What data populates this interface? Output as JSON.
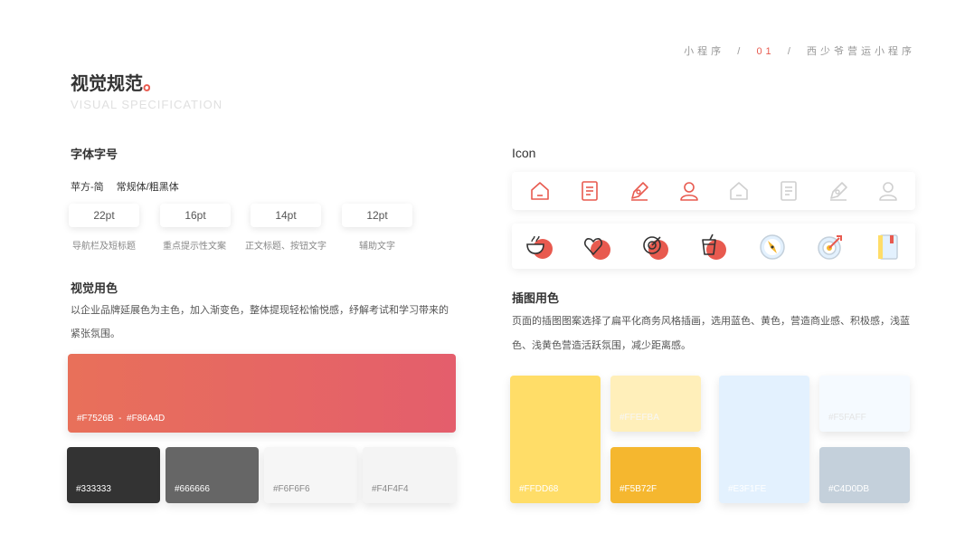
{
  "header": {
    "breadcrumb_left": "小程序",
    "breadcrumb_sep1": "/",
    "breadcrumb_num": "01",
    "breadcrumb_sep2": "/",
    "breadcrumb_right": "西少爷营运小程序",
    "title": "视觉规范",
    "title_dot": "。",
    "subtitle": "VISUAL SPECIFICATION"
  },
  "typography": {
    "heading": "字体字号",
    "font_name": "苹方-简",
    "font_weights": "常规体/粗黑体",
    "sizes": [
      {
        "size": "22pt",
        "usage": "导航栏及短标题"
      },
      {
        "size": "16pt",
        "usage": "重点提示性文案"
      },
      {
        "size": "14pt",
        "usage": "正文标题、按钮文字"
      },
      {
        "size": "12pt",
        "usage": "辅助文字"
      }
    ]
  },
  "visual_colors": {
    "heading": "视觉用色",
    "desc_line1": "以企业品牌延展色为主色，加入渐变色，整体提现轻松愉悦感，纾解考试和学习带来的",
    "desc_line2": "紧张氛围。",
    "gradient": {
      "label": "#F7526B  -  #F86A4D",
      "from": "#E8705A",
      "to": "#E45E6C"
    },
    "swatches": [
      {
        "label": "#333333",
        "color": "#333333",
        "text": "#ffffff"
      },
      {
        "label": "#666666",
        "color": "#666666",
        "text": "#ffffff"
      },
      {
        "label": "#F6F6F6",
        "color": "#F6F6F6",
        "text": "#888888"
      },
      {
        "label": "#F4F4F4",
        "color": "#F4F4F4",
        "text": "#888888"
      }
    ]
  },
  "icons": {
    "heading": "Icon",
    "outline_row": [
      "home-icon",
      "document-icon",
      "edit-icon",
      "user-icon",
      "home-icon",
      "document-icon",
      "edit-icon",
      "user-icon"
    ],
    "illustrated_row": [
      "food-bowl-icon",
      "heart-icon",
      "target-icon",
      "drink-icon",
      "compass-icon",
      "dartboard-icon",
      "notebook-icon"
    ]
  },
  "illustration_colors": {
    "heading": "插图用色",
    "desc_line1": "页面的插图图案选择了扁平化商务风格插画，选用蓝色、黄色，营造商业感、积极感，浅蓝",
    "desc_line2": "色、浅黄色营造活跃氛围，减少距离感。",
    "swatches": [
      {
        "label": "#FFDD68",
        "color": "#FFDD68",
        "text": "#ffffff"
      },
      {
        "label": "#FFEFBA",
        "color": "#FFEFBA",
        "text": "#f7f7f7"
      },
      {
        "label": "#F5B72F",
        "color": "#F5B72F",
        "text": "#ffffff"
      },
      {
        "label": "#E3F1FE",
        "color": "#E3F1FE",
        "text": "#ffffff"
      },
      {
        "label": "#F5FAFF",
        "color": "#F5FAFF",
        "text": "#e4e4e4"
      },
      {
        "label": "#C4D0DB",
        "color": "#C4D0DB",
        "text": "#ffffff"
      }
    ]
  }
}
